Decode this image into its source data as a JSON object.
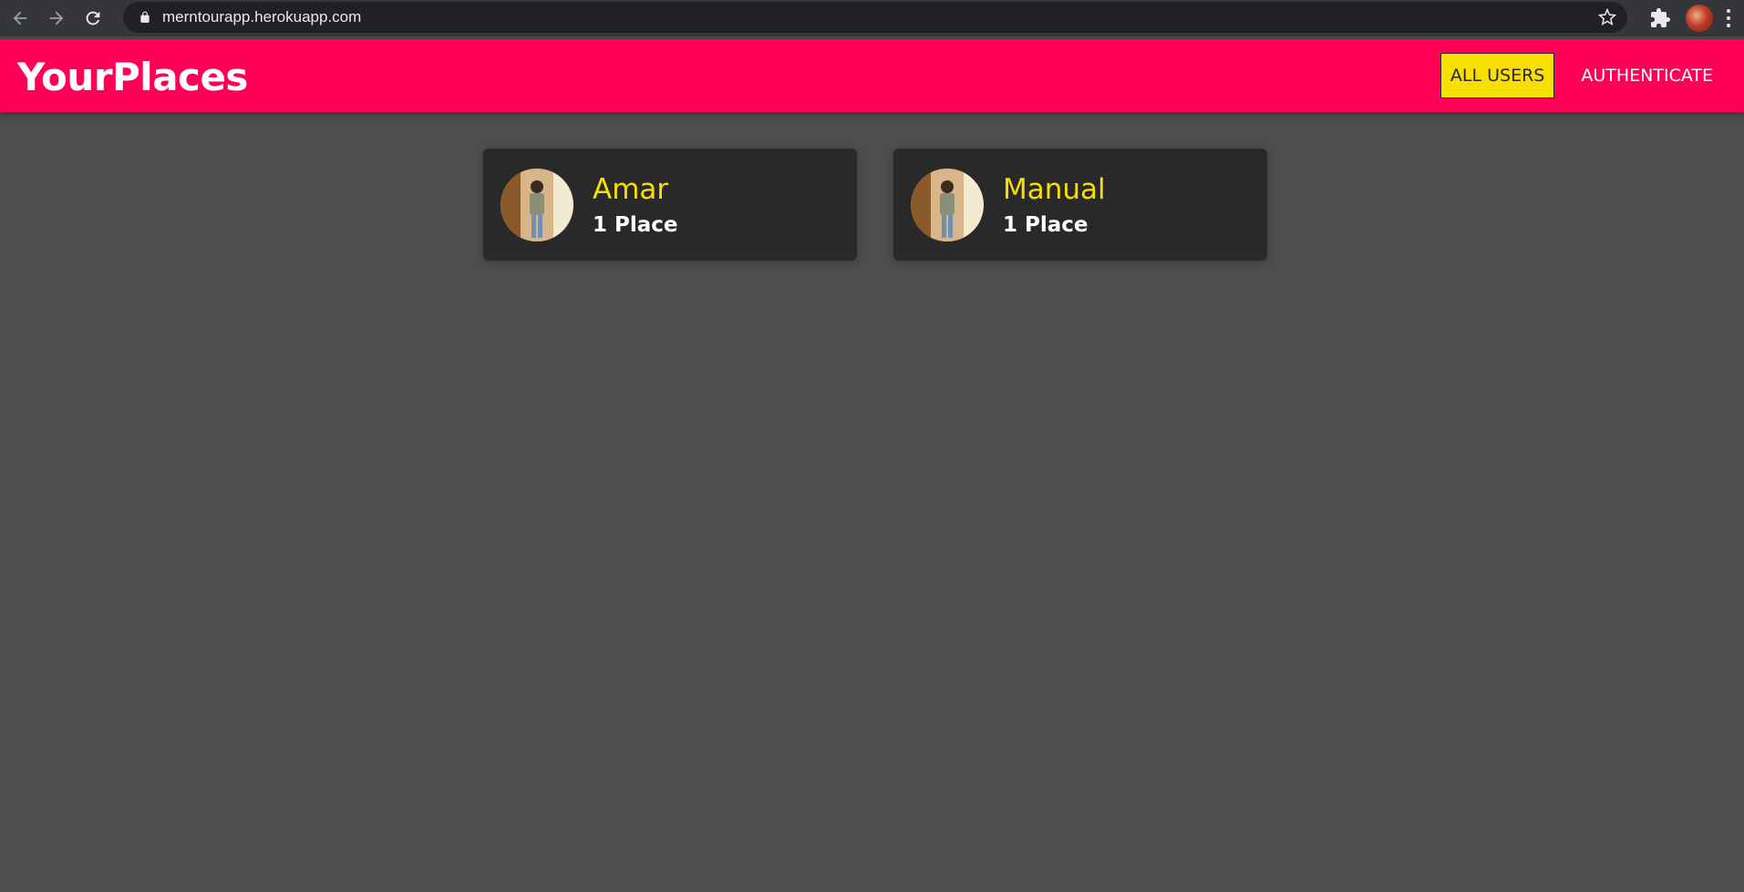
{
  "browser": {
    "url": "merntourapp.herokuapp.com",
    "icons": [
      "back-icon",
      "forward-icon",
      "reload-icon",
      "lock-icon",
      "star-icon",
      "extensions-icon",
      "profile-avatar",
      "more-icon"
    ]
  },
  "header": {
    "brand": "YourPlaces",
    "nav": {
      "all_users": "ALL USERS",
      "authenticate": "AUTHENTICATE"
    },
    "colors": {
      "background": "#ff0055",
      "active": "#f8df00"
    }
  },
  "users": [
    {
      "name": "Amar",
      "places": "1 Place"
    },
    {
      "name": "Manual",
      "places": "1 Place"
    }
  ],
  "colors": {
    "page_background": "#4d4d4d",
    "card_background": "#292929",
    "name_color": "#f8df00"
  }
}
